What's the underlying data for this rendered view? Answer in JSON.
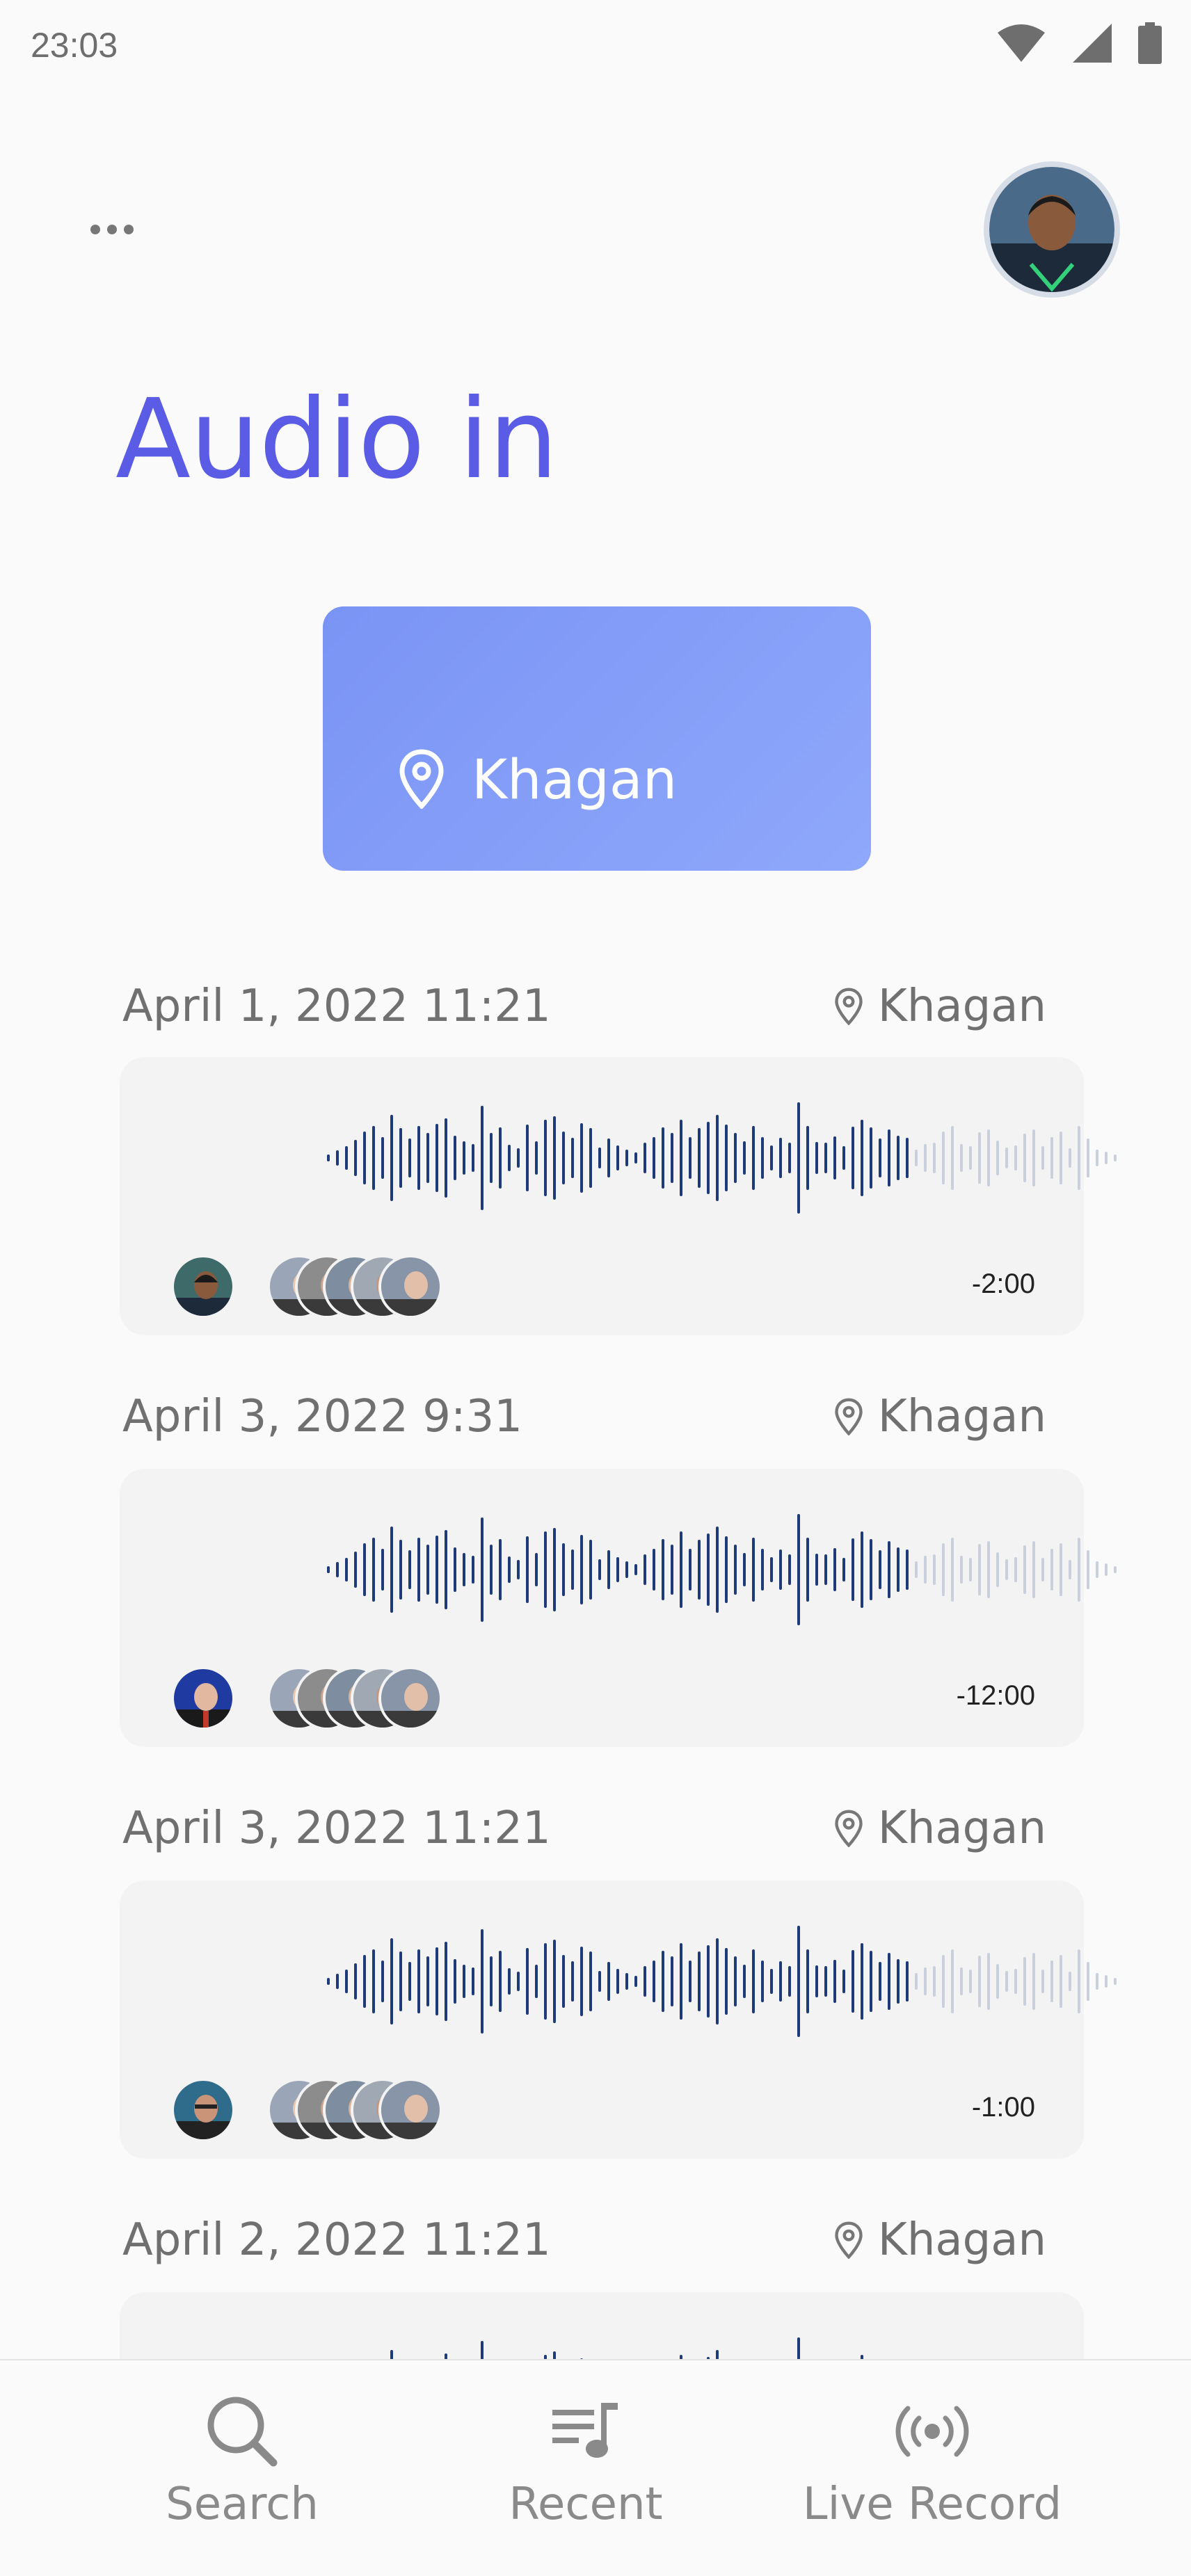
{
  "status_bar": {
    "time": "23:03",
    "icons": [
      "wifi-icon",
      "signal-icon",
      "battery-icon"
    ]
  },
  "header": {
    "more_icon": "more-dots-icon",
    "title": "Audio in"
  },
  "location_card": {
    "label": "Khagan",
    "icon": "location-pin-icon",
    "gradient": [
      "#7a94f5",
      "#8fa8fb"
    ]
  },
  "recordings": [
    {
      "date": "April 1, 2022 11:21",
      "location": "Khagan",
      "duration": "-2:00"
    },
    {
      "date": "April 3, 2022 9:31",
      "location": "Khagan",
      "duration": "-12:00"
    },
    {
      "date": "April 3, 2022 11:21",
      "location": "Khagan",
      "duration": "-1:00"
    },
    {
      "date": "April 2, 2022 11:21",
      "location": "Khagan",
      "duration": ""
    }
  ],
  "bottom_nav": {
    "items": [
      {
        "label": "Search",
        "icon": "search-icon"
      },
      {
        "label": "Recent",
        "icon": "recent-playlist-icon"
      },
      {
        "label": "Live Record",
        "icon": "live-broadcast-icon"
      }
    ]
  },
  "colors": {
    "accent": "#5b5ce6",
    "wave_played": "#1f3a78",
    "wave_unplayed": "#c9d0dc",
    "card_bg": "#f3f3f3"
  }
}
